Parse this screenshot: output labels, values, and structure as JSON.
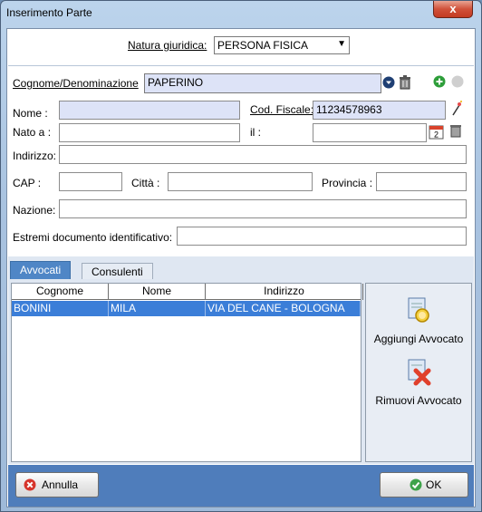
{
  "window": {
    "title": "Inserimento Parte",
    "close_glyph": "x"
  },
  "form": {
    "natura_label": "Natura giuridica:",
    "natura_value": "PERSONA FISICA",
    "cognome_label": "Cognome/Denominazione",
    "cognome_value": "PAPERINO",
    "nome_label": "Nome :",
    "nome_value": "",
    "codfisc_label": "Cod. Fiscale:",
    "codfisc_value": "11234578963",
    "nato_label": "Nato a :",
    "nato_value": "",
    "il_label": "il :",
    "il_value": "",
    "indirizzo_label": "Indirizzo:",
    "indirizzo_value": "",
    "cap_label": "CAP :",
    "cap_value": "",
    "citta_label": "Città :",
    "citta_value": "",
    "provincia_label": "Provincia :",
    "provincia_value": "",
    "nazione_label": "Nazione:",
    "nazione_value": "",
    "estremi_label": "Estremi documento identificativo:",
    "estremi_value": ""
  },
  "calendar_icon_number": "2",
  "tabs": [
    {
      "label": "Avvocati",
      "active": true
    },
    {
      "label": "Consulenti",
      "active": false
    }
  ],
  "table": {
    "headers": [
      "Cognome",
      "Nome",
      "Indirizzo"
    ],
    "rows": [
      {
        "cognome": "BONINI",
        "nome": "MILA",
        "indirizzo": "VIA DEL CANE - BOLOGNA"
      }
    ]
  },
  "side_actions": {
    "add": "Aggiungi Avvocato",
    "remove": "Rimuovi Avvocato"
  },
  "footer": {
    "cancel": "Annulla",
    "ok": "OK"
  },
  "colors": {
    "selection": "#3b7ed8",
    "footer": "#4f7dbb",
    "required_field": "#dde3f7",
    "add_green": "#2e9e3a"
  }
}
